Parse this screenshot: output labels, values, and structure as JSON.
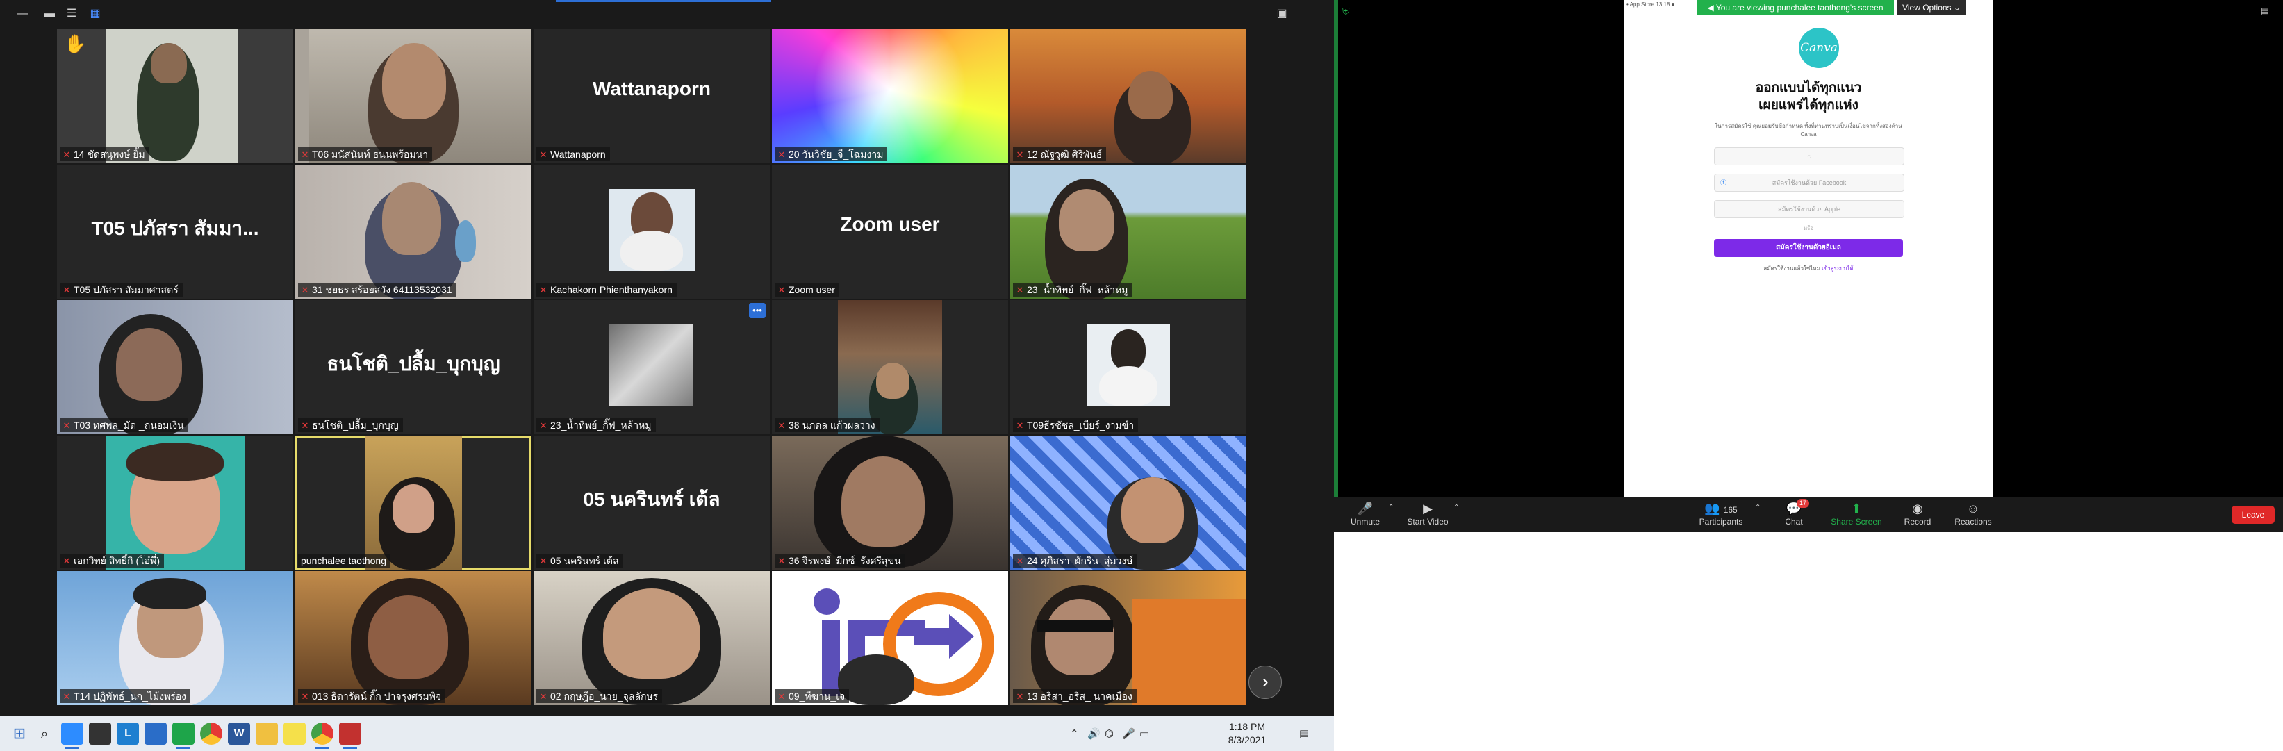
{
  "colors": {
    "gallery_background": "#1a1a1a",
    "tile_background": "#262626",
    "active_speaker_border": "#e6db6a",
    "mic_muted": "#e5393a",
    "share_banner": "#22b14c",
    "canva_purple": "#7d2ae8",
    "canva_teal": "#2cc4c7",
    "leave_red": "#e02828",
    "taskbar": "#e7ecf2"
  },
  "gallery": {
    "toolbar_icons": [
      "minimize-icon",
      "restore-icon",
      "speaker-view-icon",
      "gallery-view-icon",
      "exit-fullscreen-icon"
    ],
    "tiles": [
      {
        "label": "14 ชัดสนุพงษ์ ยิ้ม",
        "muted": true,
        "kind": "video",
        "hand_raised": true
      },
      {
        "label": "T06 มนัสนันท์ ธนนพร้อมนา",
        "muted": true,
        "kind": "video"
      },
      {
        "label": "Wattanaporn",
        "muted": true,
        "kind": "name",
        "display_name": "Wattanaporn"
      },
      {
        "label": "20 วันวิชัย_จี_โฉมงาม",
        "muted": true,
        "kind": "video"
      },
      {
        "label": "12 ณัฐวุฒิ ศิริพันธ์",
        "muted": true,
        "kind": "video"
      },
      {
        "label": "T05 ปภัสรา สัมมาศาสตร์",
        "muted": true,
        "kind": "name",
        "display_name": "T05 ปภัสรา สัมมา..."
      },
      {
        "label": "31 ชยธร สร้อยสวัง 64113532031",
        "muted": true,
        "kind": "video"
      },
      {
        "label": "Kachakorn Phienthanyakorn",
        "muted": true,
        "kind": "photo"
      },
      {
        "label": "Zoom user",
        "muted": true,
        "kind": "name",
        "display_name": "Zoom user"
      },
      {
        "label": "23_น้ำทิพย์_กิ๊ฟ_หล้าหมู",
        "muted": true,
        "kind": "video"
      },
      {
        "label": "T03 ทศพล_มัด _ถนอมเงิน",
        "muted": true,
        "kind": "video"
      },
      {
        "label": "ธนโชติ_ปลื้ม_บุกบุญ",
        "muted": true,
        "kind": "name",
        "display_name": "ธนโชติ_ปลื้ม_บุกบุญ"
      },
      {
        "label": "23_น้ำทิพย์_กิ๊ฟ_หล้าหมู",
        "muted": true,
        "kind": "photo",
        "has_more_button": true
      },
      {
        "label": "38 นภดล แก้วผลวาง",
        "muted": true,
        "kind": "video"
      },
      {
        "label": "T09ธีรชัชล_เบียร์_งามขำ",
        "muted": true,
        "kind": "photo"
      },
      {
        "label": "เอกวิทย์ สิทธิ์กิ (โอ๋พี่)",
        "muted": true,
        "kind": "avatar"
      },
      {
        "label": "punchalee taothong",
        "muted": false,
        "kind": "video",
        "active": true
      },
      {
        "label": "05 นครินทร์ เต้ล",
        "muted": true,
        "kind": "name",
        "display_name": "05 นครินทร์ เต้ล"
      },
      {
        "label": "36 จิรพงษ์_มิกซ์_รังศรีสุขน",
        "muted": true,
        "kind": "video"
      },
      {
        "label": "24 ศุภิสรา_ผักริน_สุ่มวงษ์",
        "muted": true,
        "kind": "video"
      },
      {
        "label": "T14 ปฏิพัทธ์_นก_ไม้งพร่อง",
        "muted": true,
        "kind": "video"
      },
      {
        "label": "013 ธิดารัตน์ กิ๊ก ปาจรุงศรมพิจ",
        "muted": true,
        "kind": "video"
      },
      {
        "label": "02 กฤษฎีอ_นาย_จุลลักษร",
        "muted": true,
        "kind": "video"
      },
      {
        "label": "09_ทีฆาน_เจ",
        "muted": true,
        "kind": "video"
      },
      {
        "label": "13 อริสา_อริส_ นาคเมือง",
        "muted": true,
        "kind": "video"
      }
    ],
    "next_page_icon": "chevron-right-icon"
  },
  "taskbar": {
    "time": "1:18 PM",
    "date": "8/3/2021",
    "apps": [
      "start-icon",
      "search-icon",
      "zoom-app-icon",
      "store-icon",
      "l-app-icon",
      "mail-icon",
      "line-icon",
      "chrome-icon",
      "word-icon",
      "explorer-icon",
      "sticky-icon",
      "chrome-alt-icon",
      "snip-icon"
    ]
  },
  "share": {
    "banner": "You are viewing punchalee taothong's screen",
    "view_options": "View Options ⌄",
    "store_strip": "• App Store  13:18  ●  ",
    "canva": {
      "logo": "Canva",
      "heading_line1": "ออกแบบได้ทุกแนว",
      "heading_line2": "เผยแพร่ได้ทุกแห่ง",
      "sub": "ในการสมัครใช้ คุณยอมรับข้อกำหนด ทั้งที่ท่านทราบเป็นเงื่อนไขจากทั้งสองด้าน Canva",
      "facebook": "สมัครใช้งานด้วย Facebook",
      "apple": "สมัครใช้งานด้วย Apple",
      "or": "หรือ",
      "signup": "สมัครใช้งานด้วยอีเมล",
      "login_prefix": "สมัครใช้งานแล้วใช่ไหม",
      "login_link": "เข้าสู่ระบบได้"
    },
    "controls": {
      "unmute": "Unmute",
      "start_video": "Start Video",
      "participants": "Participants",
      "participants_count": "165",
      "chat": "Chat",
      "chat_badge": "17",
      "share_screen": "Share Screen",
      "record": "Record",
      "reactions": "Reactions",
      "leave": "Leave"
    }
  }
}
